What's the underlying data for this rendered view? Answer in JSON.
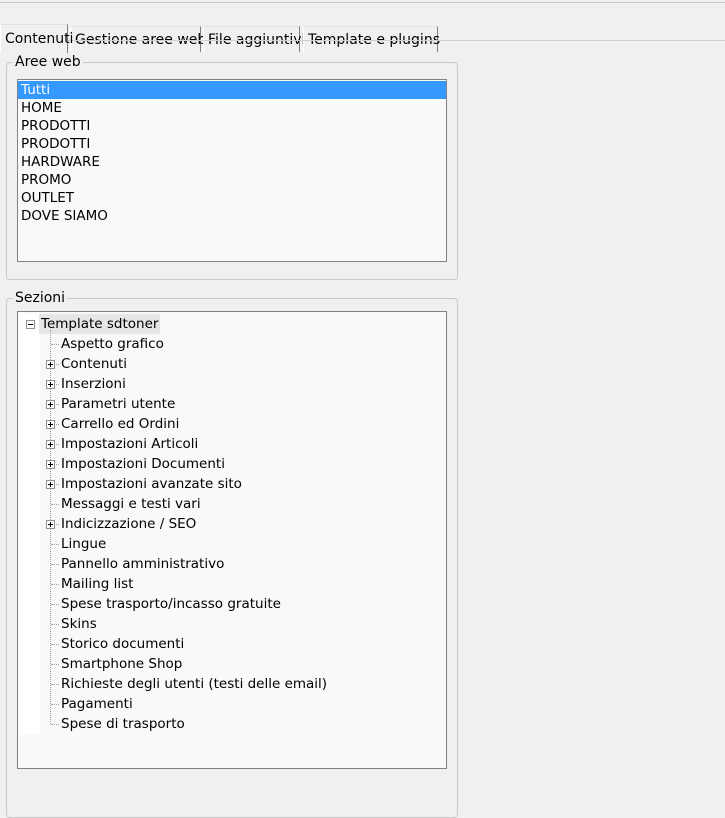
{
  "tabs": [
    {
      "label": "Contenuti",
      "active": true
    },
    {
      "label": "Gestione aree web",
      "active": false
    },
    {
      "label": "File aggiuntivi",
      "active": false
    },
    {
      "label": "Template e plugins",
      "active": false
    }
  ],
  "aree_web": {
    "title": "Aree web",
    "items": [
      "Tutti",
      "HOME",
      "PRODOTTI",
      "PRODOTTI",
      "HARDWARE",
      "PROMO",
      "OUTLET",
      "DOVE SIAMO"
    ],
    "selected_index": 0
  },
  "sezioni": {
    "title": "Sezioni",
    "root": {
      "label": "Template sdtoner",
      "expanded": true
    },
    "children": [
      {
        "label": "Aspetto grafico",
        "expandable": false
      },
      {
        "label": "Contenuti",
        "expandable": true
      },
      {
        "label": "Inserzioni",
        "expandable": true
      },
      {
        "label": "Parametri utente",
        "expandable": true
      },
      {
        "label": "Carrello ed Ordini",
        "expandable": true
      },
      {
        "label": "Impostazioni Articoli",
        "expandable": true
      },
      {
        "label": "Impostazioni Documenti",
        "expandable": true
      },
      {
        "label": "Impostazioni avanzate sito",
        "expandable": true
      },
      {
        "label": "Messaggi e testi vari",
        "expandable": false
      },
      {
        "label": "Indicizzazione / SEO",
        "expandable": true
      },
      {
        "label": "Lingue",
        "expandable": false
      },
      {
        "label": "Pannello amministrativo",
        "expandable": false
      },
      {
        "label": "Mailing list",
        "expandable": false
      },
      {
        "label": "Spese trasporto/incasso gratuite",
        "expandable": false
      },
      {
        "label": "Skins",
        "expandable": false
      },
      {
        "label": "Storico documenti",
        "expandable": false
      },
      {
        "label": "Smartphone Shop",
        "expandable": false
      },
      {
        "label": "Richieste degli utenti (testi delle email)",
        "expandable": false
      },
      {
        "label": "Pagamenti",
        "expandable": false
      },
      {
        "label": "Spese di trasporto",
        "expandable": false
      }
    ]
  },
  "colors": {
    "selection": "#3399ff",
    "background": "#f0f0f0"
  }
}
